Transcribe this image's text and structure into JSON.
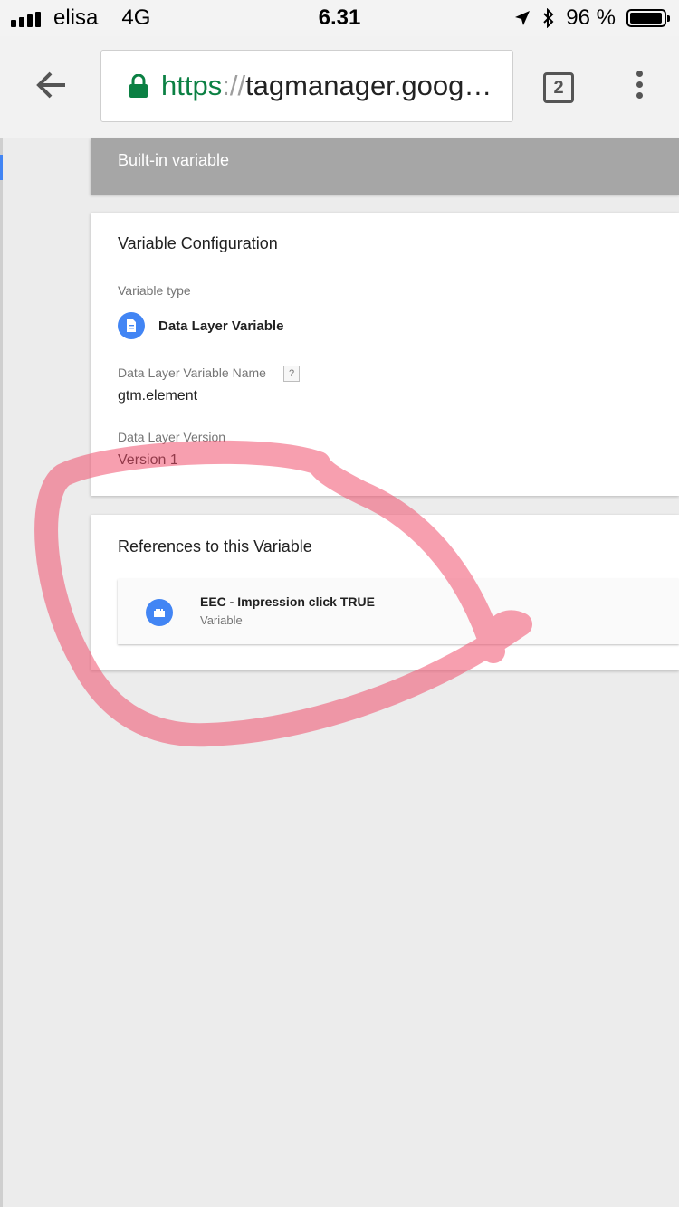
{
  "status_bar": {
    "carrier": "elisa",
    "network": "4G",
    "time": "6.31",
    "battery_percent": "96 %",
    "battery_level": 0.96
  },
  "browser": {
    "url_scheme": "https",
    "url_sep": "://",
    "url_rest": "tagmanager.goog…",
    "tab_count": "2",
    "url_scheme_color": "#0b8043"
  },
  "header": {
    "section_label": "Built-in variable"
  },
  "config": {
    "title": "Variable Configuration",
    "type_label": "Variable type",
    "type_value": "Data Layer Variable",
    "name_label": "Data Layer Variable Name",
    "help": "?",
    "name_value": "gtm.element",
    "version_label": "Data Layer Version",
    "version_value": "Version 1"
  },
  "references": {
    "title": "References to this Variable",
    "items": [
      {
        "name": "EEC - Impression click TRUE",
        "type": "Variable",
        "icon": "variable-block-icon"
      }
    ]
  },
  "colors": {
    "accent": "#4285f4",
    "annotation": "#f0506e"
  }
}
